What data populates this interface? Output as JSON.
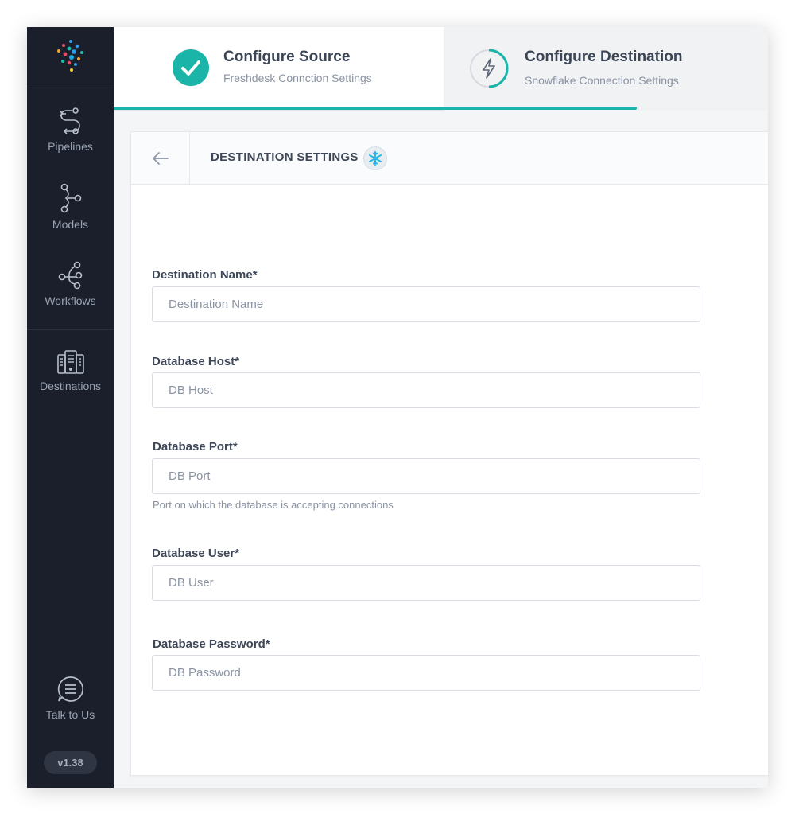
{
  "sidebar": {
    "items": [
      {
        "label": "Pipelines",
        "icon": "pipelines-icon"
      },
      {
        "label": "Models",
        "icon": "models-icon"
      },
      {
        "label": "Workflows",
        "icon": "workflows-icon"
      },
      {
        "label": "Destinations",
        "icon": "destinations-icon"
      }
    ],
    "talk": {
      "label": "Talk to Us",
      "icon": "chat-icon"
    },
    "version": "v1.38"
  },
  "steps": [
    {
      "title": "Configure Source",
      "subtitle": "Freshdesk Connction Settings",
      "status": "completed",
      "icon": "check-circle-icon"
    },
    {
      "title": "Configure Destination",
      "subtitle": "Snowflake Connection Settings",
      "status": "active",
      "icon": "lightning-icon"
    }
  ],
  "progress": 0.8,
  "card": {
    "title": "DESTINATION SETTINGS",
    "back_icon": "arrow-left-icon",
    "badge_icon": "snowflake-icon"
  },
  "form": {
    "destination_name": {
      "label": "Destination Name*",
      "placeholder": "Destination Name",
      "value": ""
    },
    "db_host": {
      "label": "Database Host*",
      "placeholder": "DB Host",
      "value": ""
    },
    "db_port": {
      "label": "Database Port*",
      "placeholder": "DB Port",
      "value": "",
      "hint": "Port on which the database is accepting connections"
    },
    "db_user": {
      "label": "Database User*",
      "placeholder": "DB User",
      "value": ""
    },
    "db_password": {
      "label": "Database Password*",
      "placeholder": "DB Password",
      "value": ""
    }
  },
  "colors": {
    "accent": "#1ab4a9",
    "sidebar_bg": "#1a1f2b",
    "snowflake": "#29b5e8"
  }
}
